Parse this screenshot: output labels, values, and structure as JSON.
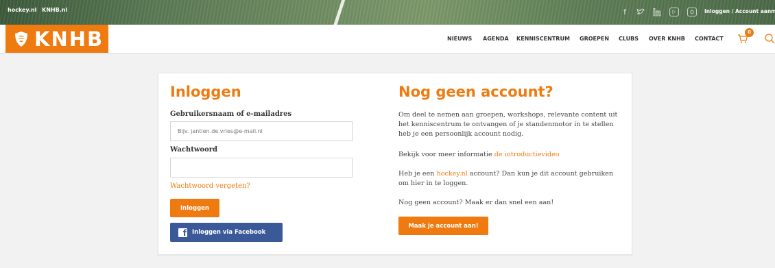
{
  "topbar": {
    "links": [
      "hockey.nl",
      "KNHB.nl"
    ],
    "social_icons": [
      "facebook-icon",
      "twitter-icon",
      "linkedin-icon",
      "youtube-icon",
      "instagram-icon"
    ],
    "login_link": "Inloggen / Account aanmaken"
  },
  "header": {
    "logo_text": "KNHB",
    "nav": [
      "NIEUWS",
      "AGENDA",
      "KENNISCENTRUM",
      "GROEPEN",
      "CLUBS",
      "OVER KNHB",
      "CONTACT"
    ],
    "cart_count": "0"
  },
  "login": {
    "title": "Inloggen",
    "username_label": "Gebruikersnaam of e-mailadres",
    "username_placeholder": "Bijv. jantien.de.vries@e-mail.nl",
    "username_value": "",
    "password_label": "Wachtwoord",
    "password_value": "",
    "forgot_link": "Wachtwoord vergeten?",
    "login_button": "Inloggen",
    "facebook_button": "Inloggen via Facebook"
  },
  "register": {
    "title": "Nog geen account?",
    "intro": "Om deel te nemen aan groepen, workshops, relevante content uit het kenniscentrum te ontvangen of je standenmotor in te stellen heb je een persoonlijk account nodig.",
    "video_prefix": "Bekijk voor meer informatie ",
    "video_link": "de introductievideo",
    "hockey_prefix": "Heb je een ",
    "hockey_link": "hockey.nl",
    "hockey_suffix": " account? Dan kun je dit account gebruiken om hier in te loggen.",
    "no_account": "Nog geen account? Maak er dan snel een aan!",
    "create_button": "Maak je account aan!"
  },
  "colors": {
    "accent": "#ef7b10",
    "facebook": "#3b5998"
  }
}
